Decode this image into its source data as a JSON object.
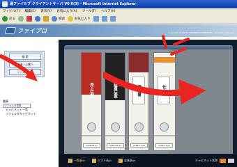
{
  "window": {
    "title": "通ファイルブ クライアントサーバ V6.0(3) - Microsoft Internet Explorer"
  },
  "menubar": {
    "items": [
      "ファイル(F)",
      "編集(E)",
      "表示(V)",
      "お気に入り(A)",
      "ツール(T)",
      "ヘルプ(H)"
    ]
  },
  "toolbar": {
    "back_label": "戻る",
    "search_label": "検索",
    "favorites_label": "お気に入り"
  },
  "page": {
    "logo_text": "ファイブロ",
    "copyright": "Copyright © 2007 CONCORD SYSTEMS INC. All rights reserved."
  },
  "left_menu": {
    "buttons": [
      "検 索",
      "新規ノ上書へ",
      "インストール"
    ]
  },
  "tree": {
    "header": "書庫",
    "select_value": "ブフォルダ書庫",
    "items": [
      "キャビネット一覧",
      "ブフォルダキャビネット"
    ]
  },
  "binders": [
    {
      "label": "売上伝票",
      "date": "2008.06.01"
    },
    {
      "label": "経費伝票",
      "date": "2008.06.04"
    },
    {
      "label": "請求書",
      "date": "2008.07.06"
    },
    {
      "label": "仕入れ",
      "date": "2008.07.06"
    }
  ],
  "bottom_bar": {
    "views": [
      "一覧表示",
      "リスト表示",
      "全体表示"
    ],
    "sort_label": "キャビネット名称"
  },
  "colors": {
    "accent_red": "#e8261f",
    "binder_red": "#b92c22",
    "shelf_dark": "#0f1d2d"
  }
}
